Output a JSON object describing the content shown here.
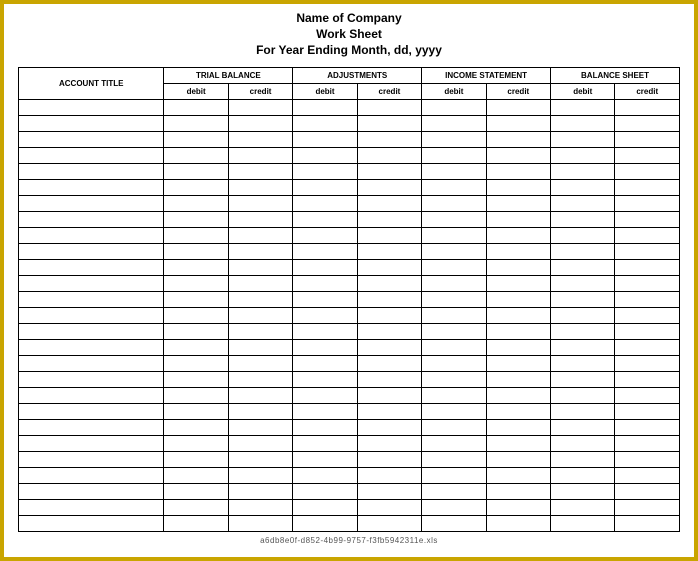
{
  "header": {
    "line1": "Name of Company",
    "line2": "Work Sheet",
    "line3": "For Year Ending Month, dd, yyyy"
  },
  "columns": {
    "account_title": "ACCOUNT TITLE",
    "sections": [
      {
        "name": "TRIAL BALANCE",
        "sub": [
          "debit",
          "credit"
        ]
      },
      {
        "name": "ADJUSTMENTS",
        "sub": [
          "debit",
          "credit"
        ]
      },
      {
        "name": "INCOME STATEMENT",
        "sub": [
          "debit",
          "credit"
        ]
      },
      {
        "name": "BALANCE SHEET",
        "sub": [
          "debit",
          "credit"
        ]
      }
    ]
  },
  "rows": [
    {
      "account": "",
      "trial_balance": {
        "debit": "",
        "credit": ""
      },
      "adjustments": {
        "debit": "",
        "credit": ""
      },
      "income_statement": {
        "debit": "",
        "credit": ""
      },
      "balance_sheet": {
        "debit": "",
        "credit": ""
      }
    },
    {
      "account": "",
      "trial_balance": {
        "debit": "",
        "credit": ""
      },
      "adjustments": {
        "debit": "",
        "credit": ""
      },
      "income_statement": {
        "debit": "",
        "credit": ""
      },
      "balance_sheet": {
        "debit": "",
        "credit": ""
      }
    },
    {
      "account": "",
      "trial_balance": {
        "debit": "",
        "credit": ""
      },
      "adjustments": {
        "debit": "",
        "credit": ""
      },
      "income_statement": {
        "debit": "",
        "credit": ""
      },
      "balance_sheet": {
        "debit": "",
        "credit": ""
      }
    },
    {
      "account": "",
      "trial_balance": {
        "debit": "",
        "credit": ""
      },
      "adjustments": {
        "debit": "",
        "credit": ""
      },
      "income_statement": {
        "debit": "",
        "credit": ""
      },
      "balance_sheet": {
        "debit": "",
        "credit": ""
      }
    },
    {
      "account": "",
      "trial_balance": {
        "debit": "",
        "credit": ""
      },
      "adjustments": {
        "debit": "",
        "credit": ""
      },
      "income_statement": {
        "debit": "",
        "credit": ""
      },
      "balance_sheet": {
        "debit": "",
        "credit": ""
      }
    },
    {
      "account": "",
      "trial_balance": {
        "debit": "",
        "credit": ""
      },
      "adjustments": {
        "debit": "",
        "credit": ""
      },
      "income_statement": {
        "debit": "",
        "credit": ""
      },
      "balance_sheet": {
        "debit": "",
        "credit": ""
      }
    },
    {
      "account": "",
      "trial_balance": {
        "debit": "",
        "credit": ""
      },
      "adjustments": {
        "debit": "",
        "credit": ""
      },
      "income_statement": {
        "debit": "",
        "credit": ""
      },
      "balance_sheet": {
        "debit": "",
        "credit": ""
      }
    },
    {
      "account": "",
      "trial_balance": {
        "debit": "",
        "credit": ""
      },
      "adjustments": {
        "debit": "",
        "credit": ""
      },
      "income_statement": {
        "debit": "",
        "credit": ""
      },
      "balance_sheet": {
        "debit": "",
        "credit": ""
      }
    },
    {
      "account": "",
      "trial_balance": {
        "debit": "",
        "credit": ""
      },
      "adjustments": {
        "debit": "",
        "credit": ""
      },
      "income_statement": {
        "debit": "",
        "credit": ""
      },
      "balance_sheet": {
        "debit": "",
        "credit": ""
      }
    },
    {
      "account": "",
      "trial_balance": {
        "debit": "",
        "credit": ""
      },
      "adjustments": {
        "debit": "",
        "credit": ""
      },
      "income_statement": {
        "debit": "",
        "credit": ""
      },
      "balance_sheet": {
        "debit": "",
        "credit": ""
      }
    },
    {
      "account": "",
      "trial_balance": {
        "debit": "",
        "credit": ""
      },
      "adjustments": {
        "debit": "",
        "credit": ""
      },
      "income_statement": {
        "debit": "",
        "credit": ""
      },
      "balance_sheet": {
        "debit": "",
        "credit": ""
      }
    },
    {
      "account": "",
      "trial_balance": {
        "debit": "",
        "credit": ""
      },
      "adjustments": {
        "debit": "",
        "credit": ""
      },
      "income_statement": {
        "debit": "",
        "credit": ""
      },
      "balance_sheet": {
        "debit": "",
        "credit": ""
      }
    },
    {
      "account": "",
      "trial_balance": {
        "debit": "",
        "credit": ""
      },
      "adjustments": {
        "debit": "",
        "credit": ""
      },
      "income_statement": {
        "debit": "",
        "credit": ""
      },
      "balance_sheet": {
        "debit": "",
        "credit": ""
      }
    },
    {
      "account": "",
      "trial_balance": {
        "debit": "",
        "credit": ""
      },
      "adjustments": {
        "debit": "",
        "credit": ""
      },
      "income_statement": {
        "debit": "",
        "credit": ""
      },
      "balance_sheet": {
        "debit": "",
        "credit": ""
      }
    },
    {
      "account": "",
      "trial_balance": {
        "debit": "",
        "credit": ""
      },
      "adjustments": {
        "debit": "",
        "credit": ""
      },
      "income_statement": {
        "debit": "",
        "credit": ""
      },
      "balance_sheet": {
        "debit": "",
        "credit": ""
      }
    },
    {
      "account": "",
      "trial_balance": {
        "debit": "",
        "credit": ""
      },
      "adjustments": {
        "debit": "",
        "credit": ""
      },
      "income_statement": {
        "debit": "",
        "credit": ""
      },
      "balance_sheet": {
        "debit": "",
        "credit": ""
      }
    },
    {
      "account": "",
      "trial_balance": {
        "debit": "",
        "credit": ""
      },
      "adjustments": {
        "debit": "",
        "credit": ""
      },
      "income_statement": {
        "debit": "",
        "credit": ""
      },
      "balance_sheet": {
        "debit": "",
        "credit": ""
      }
    },
    {
      "account": "",
      "trial_balance": {
        "debit": "",
        "credit": ""
      },
      "adjustments": {
        "debit": "",
        "credit": ""
      },
      "income_statement": {
        "debit": "",
        "credit": ""
      },
      "balance_sheet": {
        "debit": "",
        "credit": ""
      }
    },
    {
      "account": "",
      "trial_balance": {
        "debit": "",
        "credit": ""
      },
      "adjustments": {
        "debit": "",
        "credit": ""
      },
      "income_statement": {
        "debit": "",
        "credit": ""
      },
      "balance_sheet": {
        "debit": "",
        "credit": ""
      }
    },
    {
      "account": "",
      "trial_balance": {
        "debit": "",
        "credit": ""
      },
      "adjustments": {
        "debit": "",
        "credit": ""
      },
      "income_statement": {
        "debit": "",
        "credit": ""
      },
      "balance_sheet": {
        "debit": "",
        "credit": ""
      }
    },
    {
      "account": "",
      "trial_balance": {
        "debit": "",
        "credit": ""
      },
      "adjustments": {
        "debit": "",
        "credit": ""
      },
      "income_statement": {
        "debit": "",
        "credit": ""
      },
      "balance_sheet": {
        "debit": "",
        "credit": ""
      }
    },
    {
      "account": "",
      "trial_balance": {
        "debit": "",
        "credit": ""
      },
      "adjustments": {
        "debit": "",
        "credit": ""
      },
      "income_statement": {
        "debit": "",
        "credit": ""
      },
      "balance_sheet": {
        "debit": "",
        "credit": ""
      }
    },
    {
      "account": "",
      "trial_balance": {
        "debit": "",
        "credit": ""
      },
      "adjustments": {
        "debit": "",
        "credit": ""
      },
      "income_statement": {
        "debit": "",
        "credit": ""
      },
      "balance_sheet": {
        "debit": "",
        "credit": ""
      }
    },
    {
      "account": "",
      "trial_balance": {
        "debit": "",
        "credit": ""
      },
      "adjustments": {
        "debit": "",
        "credit": ""
      },
      "income_statement": {
        "debit": "",
        "credit": ""
      },
      "balance_sheet": {
        "debit": "",
        "credit": ""
      }
    },
    {
      "account": "",
      "trial_balance": {
        "debit": "",
        "credit": ""
      },
      "adjustments": {
        "debit": "",
        "credit": ""
      },
      "income_statement": {
        "debit": "",
        "credit": ""
      },
      "balance_sheet": {
        "debit": "",
        "credit": ""
      }
    },
    {
      "account": "",
      "trial_balance": {
        "debit": "",
        "credit": ""
      },
      "adjustments": {
        "debit": "",
        "credit": ""
      },
      "income_statement": {
        "debit": "",
        "credit": ""
      },
      "balance_sheet": {
        "debit": "",
        "credit": ""
      }
    },
    {
      "account": "",
      "trial_balance": {
        "debit": "",
        "credit": ""
      },
      "adjustments": {
        "debit": "",
        "credit": ""
      },
      "income_statement": {
        "debit": "",
        "credit": ""
      },
      "balance_sheet": {
        "debit": "",
        "credit": ""
      }
    }
  ],
  "footer_id": "a6db8e0f-d852-4b99-9757-f3fb5942311e.xls"
}
